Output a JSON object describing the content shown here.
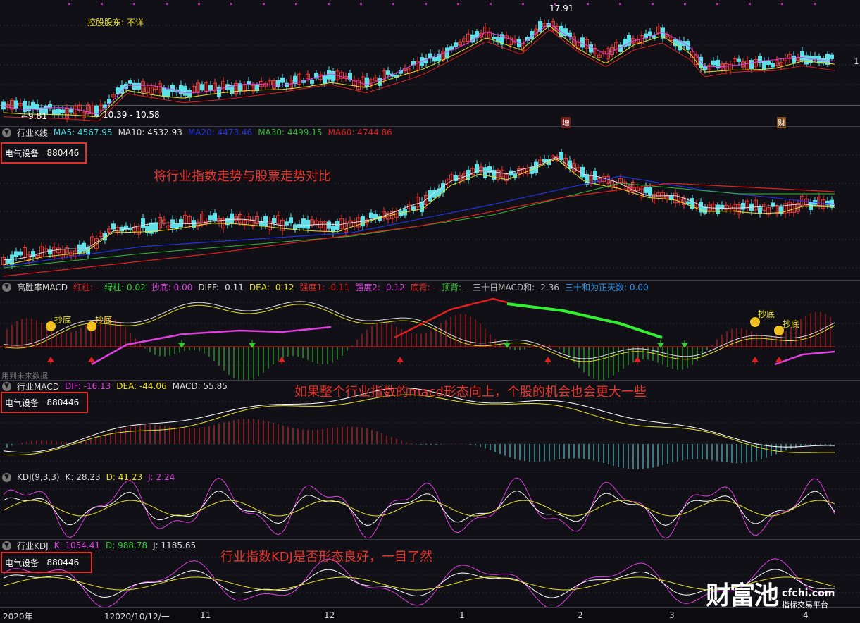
{
  "price_panel": {
    "holder_label": "控股股东:",
    "holder_value": "不详",
    "high_label": "17.91",
    "low_label": "←9.81",
    "range_label": "10.39 - 10.58",
    "event_marker": "增",
    "event_marker2": "财",
    "right_tick": "1"
  },
  "industry_kline": {
    "title": "行业K线",
    "ma": [
      {
        "label": "MA5: 4567.95",
        "color": "#3fd8e0"
      },
      {
        "label": "MA10: 4532.93",
        "color": "#dcdcdc"
      },
      {
        "label": "MA20: 4473.46",
        "color": "#2233dd"
      },
      {
        "label": "MA30: 4499.15",
        "color": "#33bb33"
      },
      {
        "label": "MA60: 4744.86",
        "color": "#e02020"
      }
    ],
    "box_name": "电气设备",
    "box_code": "880446",
    "annotation": "将行业指数走势与股票走势对比"
  },
  "macd_win": {
    "title": "高胜率MACD",
    "items": [
      {
        "label": "红柱: -",
        "color": "#e02020"
      },
      {
        "label": "绿柱: 0.02",
        "color": "#33cc33"
      },
      {
        "label": "抄底: 0.00",
        "color": "#e040e0"
      },
      {
        "label": "DIFF: -0.11",
        "color": "#dddddd"
      },
      {
        "label": "DEA: -0.12",
        "color": "#e8e020"
      },
      {
        "label": "强度1: -0.11",
        "color": "#e02020"
      },
      {
        "label": "强度2: -0.12",
        "color": "#e040e0"
      },
      {
        "label": "底背: -",
        "color": "#e02020"
      },
      {
        "label": "顶背: -",
        "color": "#33cc33"
      },
      {
        "label": "三十日MACD和: -2.36",
        "color": "#bbbbbb"
      },
      {
        "label": "三十和为正天数: 0.00",
        "color": "#3399ee"
      }
    ],
    "note": "用到未来数据",
    "bottom_labels": [
      {
        "text": "抄底"
      },
      {
        "text": "抄底"
      },
      {
        "text": "抄底"
      },
      {
        "text": "抄底"
      }
    ]
  },
  "industry_macd": {
    "title": "行业MACD",
    "items": [
      {
        "label": "DIF: -16.13",
        "color": "#e040e0"
      },
      {
        "label": "DEA: -44.06",
        "color": "#e8e020"
      },
      {
        "label": "MACD: 55.85",
        "color": "#dddddd"
      }
    ],
    "box_name": "电气设备",
    "box_code": "880446",
    "annotation": "如果整个行业指数的macd形态向上，个股的机会也会更大一些"
  },
  "kdj": {
    "title": "KDJ(9,3,3)",
    "items": [
      {
        "label": "K: 28.23",
        "color": "#dddddd"
      },
      {
        "label": "D: 41.23",
        "color": "#e8e020"
      },
      {
        "label": "J: 2.24",
        "color": "#e040e0"
      }
    ]
  },
  "industry_kdj": {
    "title": "行业KDJ",
    "items": [
      {
        "label": "K: 1054.41",
        "color": "#e040e0"
      },
      {
        "label": "D: 988.78",
        "color": "#33cc33"
      },
      {
        "label": "J: 1185.65",
        "color": "#dddddd"
      }
    ],
    "box_name": "电气设备",
    "box_code": "880446",
    "annotation": "行业指数KDJ是否形态良好，一目了然"
  },
  "xaxis": [
    "2020年",
    "12020/10/12/一",
    "11",
    "12",
    "1",
    "2",
    "3",
    "4"
  ],
  "watermark": {
    "brand": "财富池",
    "site": "cfchi.com",
    "slogan": "指标交易平台"
  }
}
